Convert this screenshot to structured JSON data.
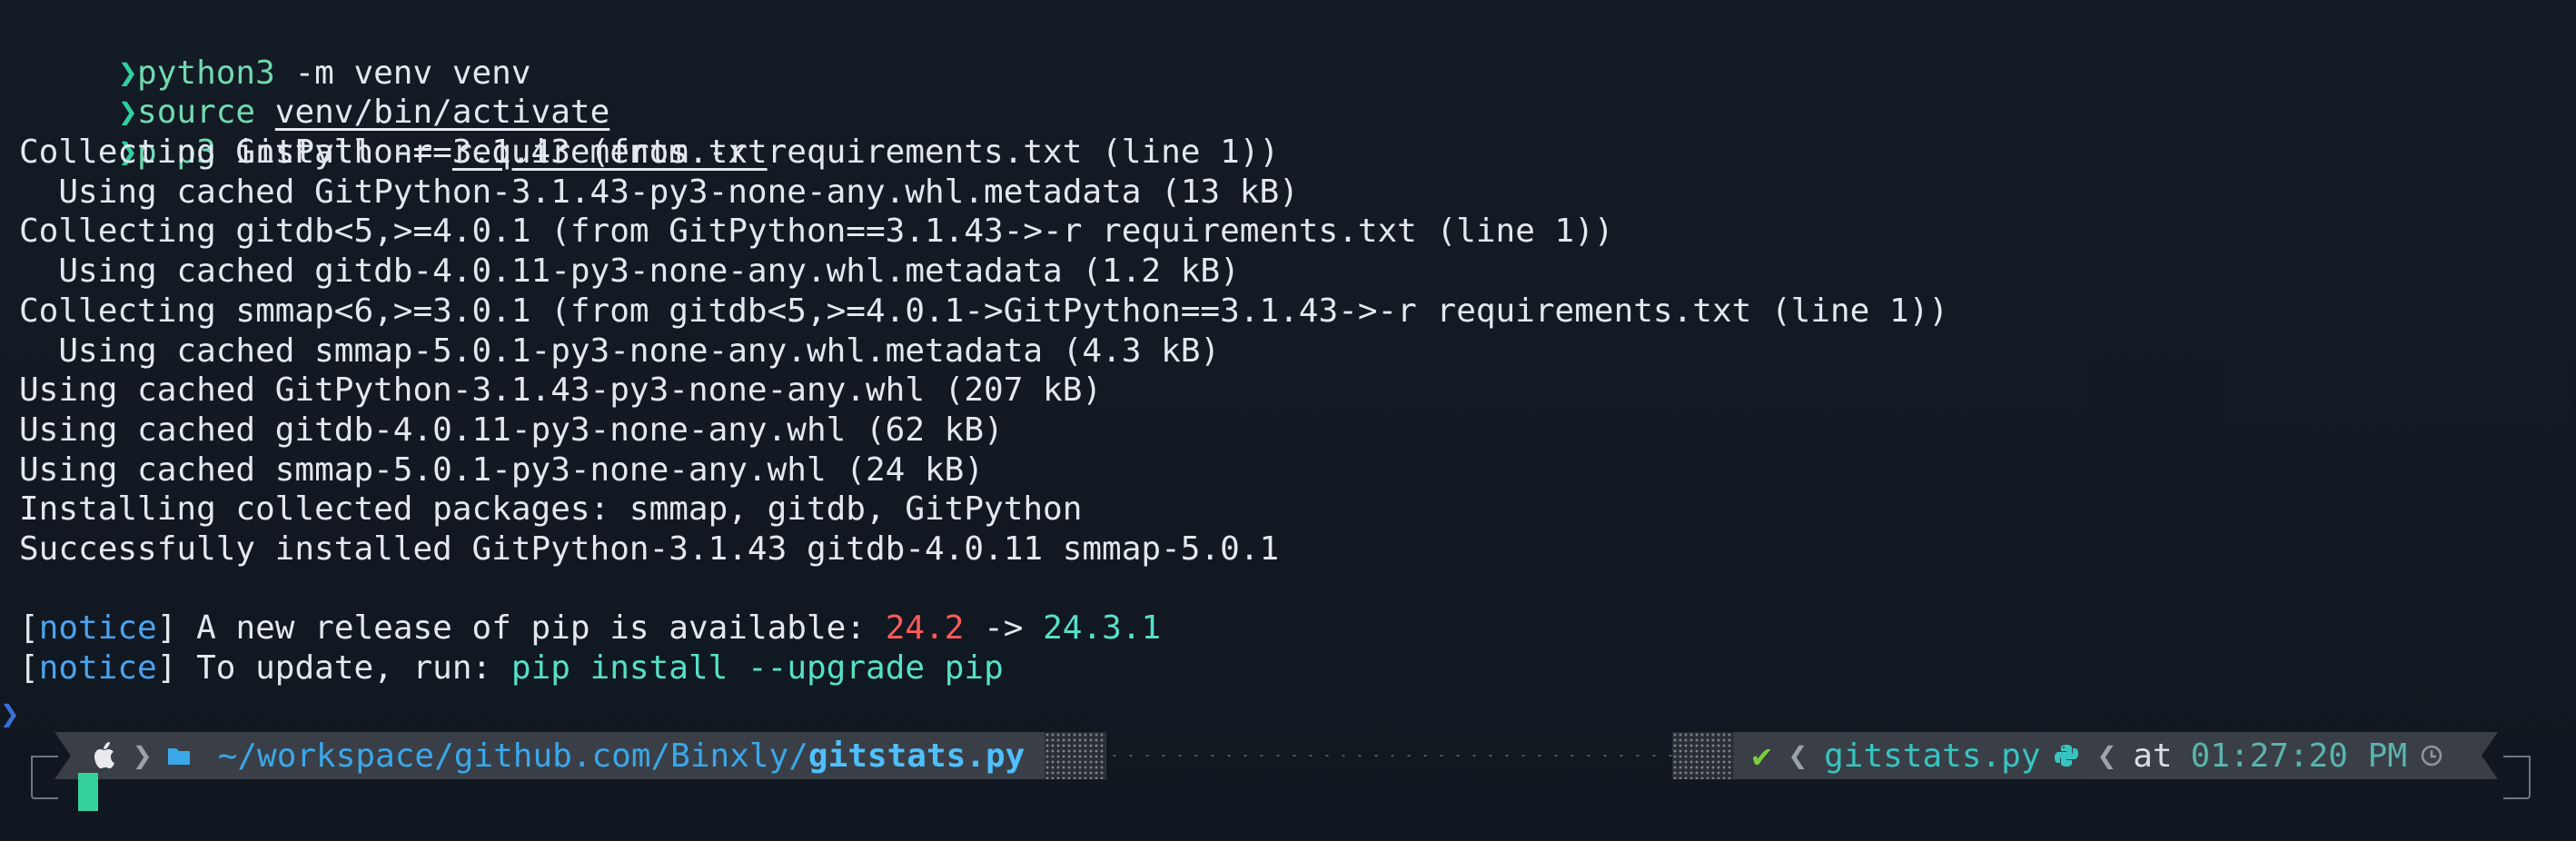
{
  "terminal": {
    "prompts": [
      {
        "cmd": "python3",
        "args": " -m venv venv",
        "arg_underlined": ""
      },
      {
        "cmd": "source",
        "args": " ",
        "arg_underlined": "venv/bin/activate"
      },
      {
        "cmd": "pip3",
        "args": " install -r ",
        "arg_underlined": "requirements.txt"
      }
    ],
    "output": [
      "Collecting GitPython==3.1.43 (from -r requirements.txt (line 1))",
      "  Using cached GitPython-3.1.43-py3-none-any.whl.metadata (13 kB)",
      "Collecting gitdb<5,>=4.0.1 (from GitPython==3.1.43->-r requirements.txt (line 1))",
      "  Using cached gitdb-4.0.11-py3-none-any.whl.metadata (1.2 kB)",
      "Collecting smmap<6,>=3.0.1 (from gitdb<5,>=4.0.1->GitPython==3.1.43->-r requirements.txt (line 1))",
      "  Using cached smmap-5.0.1-py3-none-any.whl.metadata (4.3 kB)",
      "Using cached GitPython-3.1.43-py3-none-any.whl (207 kB)",
      "Using cached gitdb-4.0.11-py3-none-any.whl (62 kB)",
      "Using cached smmap-5.0.1-py3-none-any.whl (24 kB)",
      "Installing collected packages: smmap, gitdb, GitPython",
      "Successfully installed GitPython-3.1.43 gitdb-4.0.11 smmap-5.0.1"
    ],
    "notice1": {
      "tag": "notice",
      "text": " A new release of pip is available: ",
      "old": "24.2",
      "arrow": " -> ",
      "new": "24.3.1"
    },
    "notice2": {
      "tag": "notice",
      "text": " To update, run: ",
      "cmd": "pip install --upgrade pip"
    },
    "prompt_symbol": "❯"
  },
  "statusbar": {
    "path_prefix": "~/workspace/github.com/Binxly/",
    "path_current": "gitstats.py",
    "status_check": "✔",
    "file": "gitstats.py",
    "at_label": "at",
    "time": "01:27:20 PM"
  },
  "icons": {
    "os": "apple-icon",
    "folder": "folder-icon",
    "language": "python-icon",
    "clock": "clock-icon",
    "check": "check-icon"
  },
  "colors": {
    "background": "#0d141d",
    "text": "#e3e8ee",
    "prompt_chevron": "#2fd0a0",
    "path": "#3ba7e8",
    "notice": "#4aa3ef",
    "version_old": "#ff5a5a",
    "version_new": "#57e0c8",
    "cursor": "#35d19a"
  }
}
